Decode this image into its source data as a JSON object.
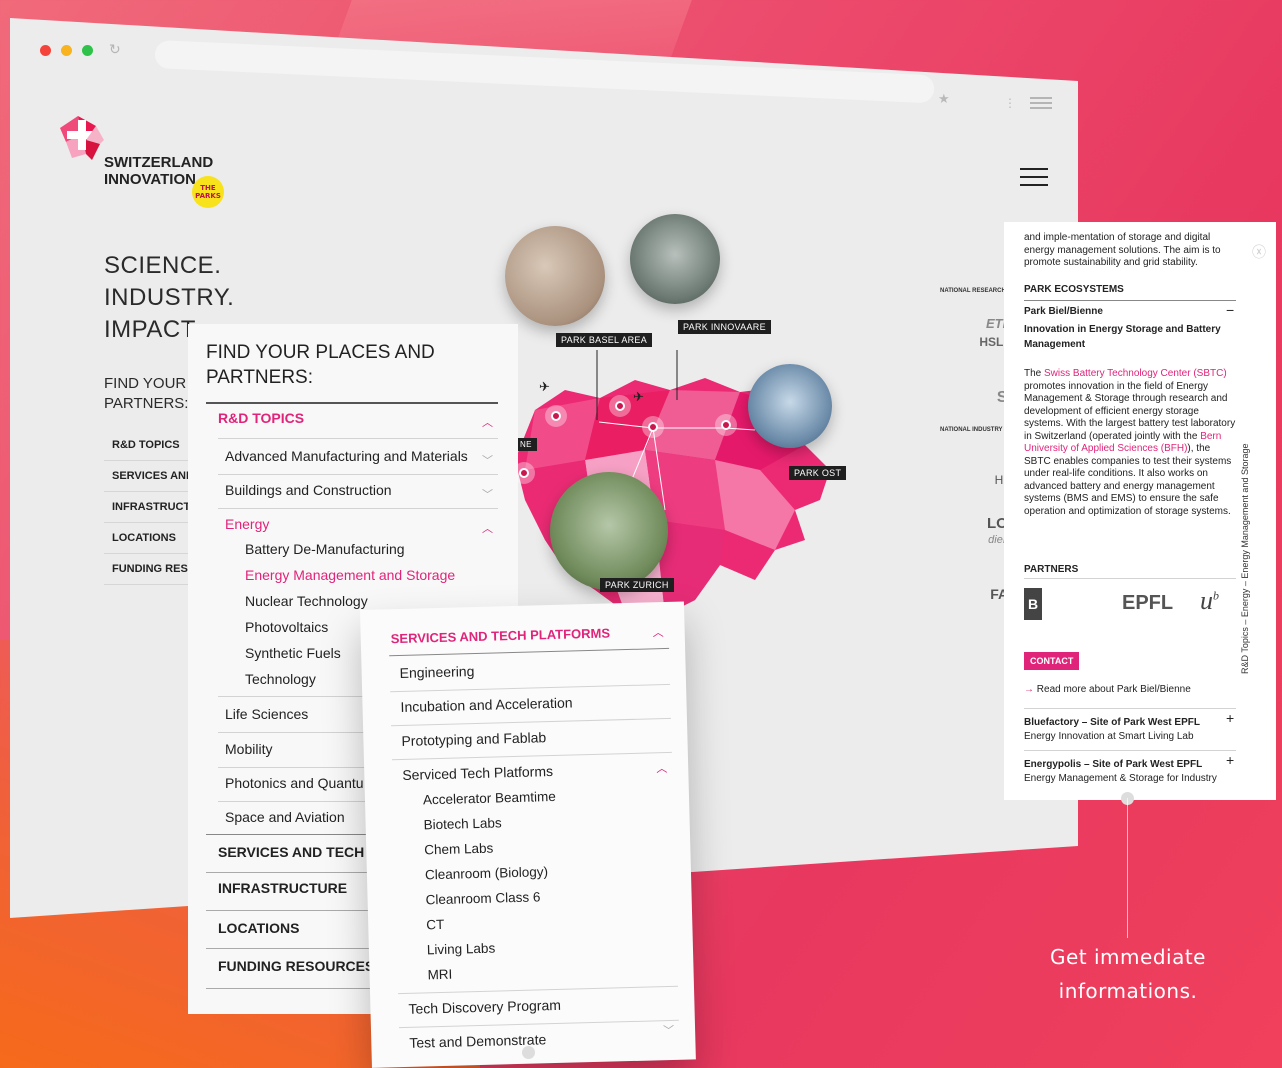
{
  "browser": {
    "reload_icon": "reload-icon",
    "bookmark_icon": "star-icon"
  },
  "brand": {
    "line1": "SWITZERLAND",
    "line2": "INNOVATION",
    "badge_line1": "THE",
    "badge_line2": "PARKS"
  },
  "hero": {
    "line1": "SCIENCE.",
    "line2": "INDUSTRY.",
    "line3": "IMPACT."
  },
  "background_nav": {
    "label_line1": "FIND YOUR P",
    "label_line2": "PARTNERS:",
    "items": [
      "R&D TOPICS",
      "SERVICES AND",
      "INFRASTRUCTU",
      "LOCATIONS",
      "FUNDING RESO"
    ]
  },
  "map": {
    "parks": [
      "PARK BASEL AREA",
      "PARK INNOVAARE",
      "PARK OST",
      "PARK ZURICH"
    ],
    "edge_label": "NE"
  },
  "right_logos": {
    "top_label": "NATIONAL RESEARCH I",
    "items": [
      "ETH",
      "HSLU",
      "SI",
      "NATIONAL INDUSTRY I",
      "HC",
      "LOI",
      "dieM",
      "FAI"
    ]
  },
  "panel_topics": {
    "title_line1": "FIND YOUR PLACES AND",
    "title_line2": "PARTNERS:",
    "rd_head": "R&D TOPICS",
    "topics": [
      "Advanced Manufacturing and Materials",
      "Buildings and Construction"
    ],
    "energy": "Energy",
    "energy_subs": [
      "Battery De-Manufacturing",
      "Energy Management and Storage",
      "Nuclear Technology",
      "Photovoltaics",
      "Synthetic Fuels",
      "Technology"
    ],
    "more_topics": [
      "Life Sciences",
      "Mobility",
      "Photonics and Quantu",
      "Space and Aviation"
    ],
    "categories": [
      "SERVICES AND TECH P",
      "INFRASTRUCTURE",
      "LOCATIONS",
      "FUNDING RESOURCES"
    ]
  },
  "panel_services": {
    "head": "SERVICES AND TECH PLATFORMS",
    "items": [
      "Engineering",
      "Incubation and Acceleration",
      "Prototyping and Fablab"
    ],
    "platforms": "Serviced Tech Platforms",
    "platform_subs": [
      "Accelerator Beamtime",
      "Biotech Labs",
      "Chem Labs",
      "Cleanroom (Biology)",
      "Cleanroom Class 6",
      "CT",
      "Living Labs",
      "MRI"
    ],
    "tail": [
      "Tech Discovery Program",
      "Test and Demonstrate"
    ]
  },
  "panel_detail": {
    "intro": "and imple-mentation of storage and digital energy management solutions. The aim is to promote sustainability and grid stability.",
    "ecosystems_head": "PARK ECOSYSTEMS",
    "park_name": "Park Biel/Bienne",
    "park_subtitle": "Innovation in Energy Storage and Battery Management",
    "body_pre": "The ",
    "body_link1": "Swiss Battery Technology Center (SBTC)",
    "body_mid": " promotes innovation in the field of Energy Management & Storage through research and development of efficient energy storage systems. With the largest battery test laboratory in Switzerland (operated jointly with the ",
    "body_link2": "Bern University of Applied Sciences (BFH)",
    "body_post": "), the SBTC enables companies to test their systems under real-life conditions. It also works on advanced battery and energy management systems (BMS and EMS) to ensure the safe operation and optimization of storage systems.",
    "partners_head": "PARTNERS",
    "partner_bfh": "B",
    "partner_epfl": "EPFL",
    "partner_unibe": "u",
    "partner_unibe_sup": "b",
    "contact": "CONTACT",
    "read_more": "Read more about Park Biel/Bienne",
    "sites": [
      {
        "name": "Bluefactory – Site of Park West EPFL",
        "desc": "Energy Innovation at Smart Living Lab"
      },
      {
        "name": "Energypolis – Site of Park West EPFL",
        "desc": "Energy Management & Storage for Industry"
      }
    ],
    "side_label": "R&D Topics – Energy – Energy Management and Storage"
  },
  "callout": {
    "line1": "Get immediate",
    "line2": "informations."
  },
  "colors": {
    "accent": "#e0247a",
    "bg": "#ec4a6c"
  }
}
